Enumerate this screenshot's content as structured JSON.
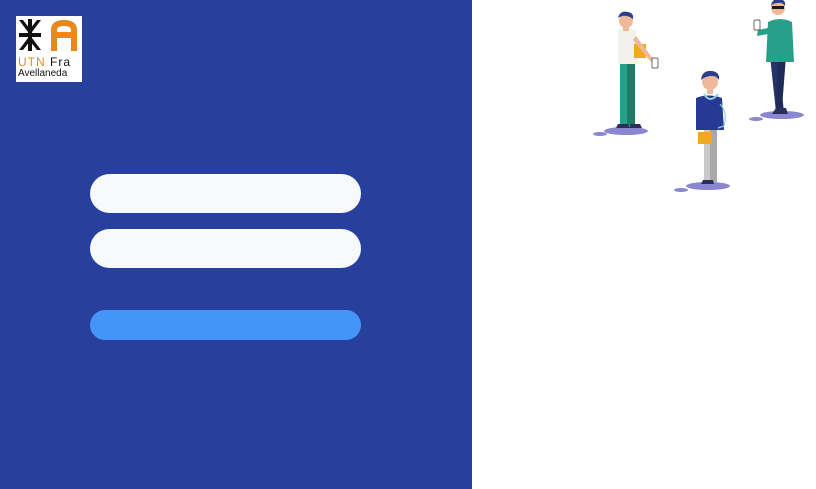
{
  "colors": {
    "panel": "#27409e",
    "field": "#f8f9fb",
    "button": "#4595f9",
    "logo_orange": "#e8891f"
  },
  "logo": {
    "line1_utn": "UTN",
    "line1_fra": "Fra",
    "line2": "Avellaneda",
    "icon": "utn-emblem-icon"
  },
  "form": {
    "username_value": "",
    "password_value": "",
    "submit_label": ""
  },
  "illustration": {
    "icon": "people-with-phones-illustration"
  }
}
